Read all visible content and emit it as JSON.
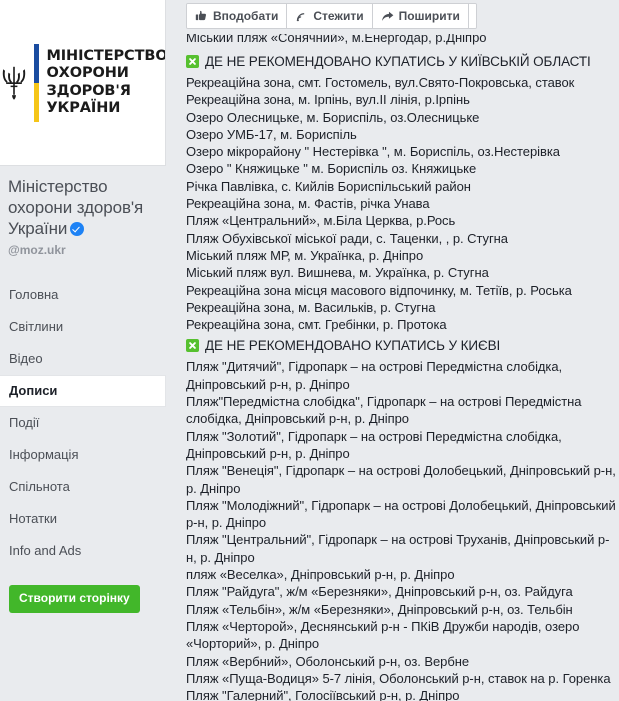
{
  "sidebar": {
    "logo": {
      "icon": "ukraine-trident-emblem",
      "line1": "МІНІСТЕРСТВО",
      "line2": "ОХОРОНИ",
      "line3": "ЗДОРОВ'Я",
      "line4": "УКРАЇНИ"
    },
    "page_name": "Міністерство охорони здоров'я України",
    "verified_icon": "verified-check-icon",
    "handle": "@moz.ukr",
    "nav_items": [
      {
        "label": "Головна",
        "active": false
      },
      {
        "label": "Світлини",
        "active": false
      },
      {
        "label": "Відео",
        "active": false
      },
      {
        "label": "Дописи",
        "active": true
      },
      {
        "label": "Події",
        "active": false
      },
      {
        "label": "Інформація",
        "active": false
      },
      {
        "label": "Спільнота",
        "active": false
      },
      {
        "label": "Нотатки",
        "active": false
      },
      {
        "label": "Info and Ads",
        "active": false
      }
    ],
    "create_page_label": "Створити сторінку",
    "create_page_color": "#42b72a"
  },
  "toolbar": {
    "like_label": "Вподобати",
    "like_icon": "thumbs-up-icon",
    "follow_label": "Стежити",
    "follow_icon": "rss-feed-icon",
    "share_label": "Поширити",
    "share_icon": "share-arrow-icon",
    "more_label": "•••",
    "more_icon": "ellipsis-icon"
  },
  "post": {
    "clipped_top_line": "Міський пляж «Сонячний», м.Енергодар, р.Дніпро",
    "sections": [
      {
        "icon": "green-x-icon",
        "icon_color": "#56c02f",
        "title": "ДЕ НЕ РЕКОМЕНДОВАНО КУПАТИСЬ У КИЇВСЬКІЙ ОБЛАСТІ",
        "entries": [
          "Рекреаційна зона, смт. Гостомель, вул.Свято-Покровська, ставок",
          "Рекреаційна зона, м. Ірпінь, вул.ІІ лінія, р.Ірпінь",
          "Озеро Олесницьке, м. Бориспіль, оз.Олесницьке",
          "Озеро УМБ-17, м. Бориспіль",
          "Озеро мікрорайону \" Нестерівка \", м. Бориспіль, оз.Нестерівка",
          "Озеро \" Княжицьке \" м. Бориспіль оз. Княжицьке",
          "Річка Павлівка, с. Кийлів Бориспільський район",
          "Рекреаційна зона, м. Фастів, річка Унава",
          "Пляж «Центральний», м.Біла Церква, р.Рось",
          "Пляж Обухівської міської ради, с. Таценки, , р. Стугна",
          "Міський пляж МР, м. Українка, р. Дніпро",
          "Міський пляж вул. Вишнева, м. Українка, р. Стугна",
          "Рекреаційна зона місця масового відпочинку, м. Тетіїв, р. Роська",
          "Рекреаційна зона, м. Васильків, р. Стугна",
          "Рекреаційна зона, смт. Гребінки, р. Протока"
        ]
      },
      {
        "icon": "green-x-icon",
        "icon_color": "#56c02f",
        "title": "ДЕ НЕ РЕКОМЕНДОВАНО КУПАТИСЬ У КИЄВІ",
        "entries": [
          "Пляж \"Дитячий\", Гідропарк – на острові Передмістна слобідка, Дніпровський р-н, р. Дніпро",
          "Пляж\"Передмістна слобідка\", Гідропарк – на острові Передмістна слобідка, Дніпровський р-н, р. Дніпро",
          "Пляж \"Золотий\", Гідропарк – на острові Передмістна слобідка, Дніпровський р-н, р. Дніпро",
          "Пляж \"Венеція\", Гідропарк – на острові Долобецький, Дніпровський р-н, р. Дніпро",
          "Пляж \"Молодіжний\", Гідропарк – на острові Долобецький, Дніпровський р-н, р. Дніпро",
          "Пляж \"Центральний\", Гідропарк – на острові Труханів, Дніпровський р-н, р. Дніпро",
          "пляж «Веселка», Дніпровський р-н, р. Дніпро",
          "Пляж \"Райдуга\", ж/м «Березняки», Дніпровський р-н, оз. Райдуга",
          "Пляж «Тельбін», ж/м «Березняки», Дніпровський р-н, оз. Тельбін",
          "Пляж «Черторой», Деснянський р-н - ПКіВ Дружби народів, озеро «Чорторий», р. Дніпро",
          "Пляж «Вербний», Оболонський р-н, оз. Вербне",
          "Пляж «Пуща-Водиця» 5-7 лінія, Оболонський р-н, ставок на р. Горенка",
          "Пляж \"Галерний\", Голосіївський р-н, р. Дніпро"
        ]
      }
    ]
  }
}
